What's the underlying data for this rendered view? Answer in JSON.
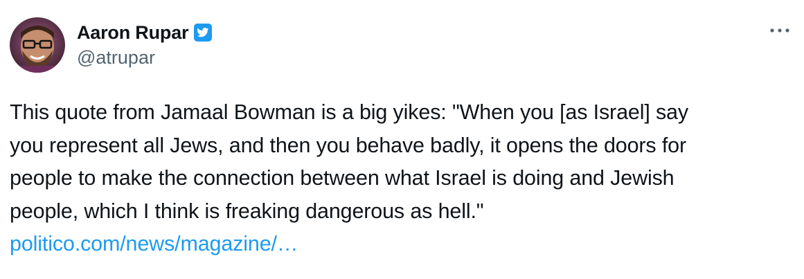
{
  "author": {
    "display_name": "Aaron Rupar",
    "handle": "@atrupar",
    "verified": true
  },
  "menu_icon": "more-horizontal-icon",
  "tweet": {
    "lines": [
      "This quote from Jamaal Bowman is a big yikes: \"When you [as Israel] say",
      "you represent all Jews, and then you behave badly, it opens the doors for",
      "people to make the connection between what Israel is doing and Jewish",
      "people, which I think is freaking dangerous as hell.\""
    ],
    "link": "politico.com/news/magazine/…"
  },
  "colors": {
    "text": "#0f1419",
    "secondary": "#536471",
    "link": "#1d9bf0",
    "verified_badge": "#1d9bf0"
  }
}
